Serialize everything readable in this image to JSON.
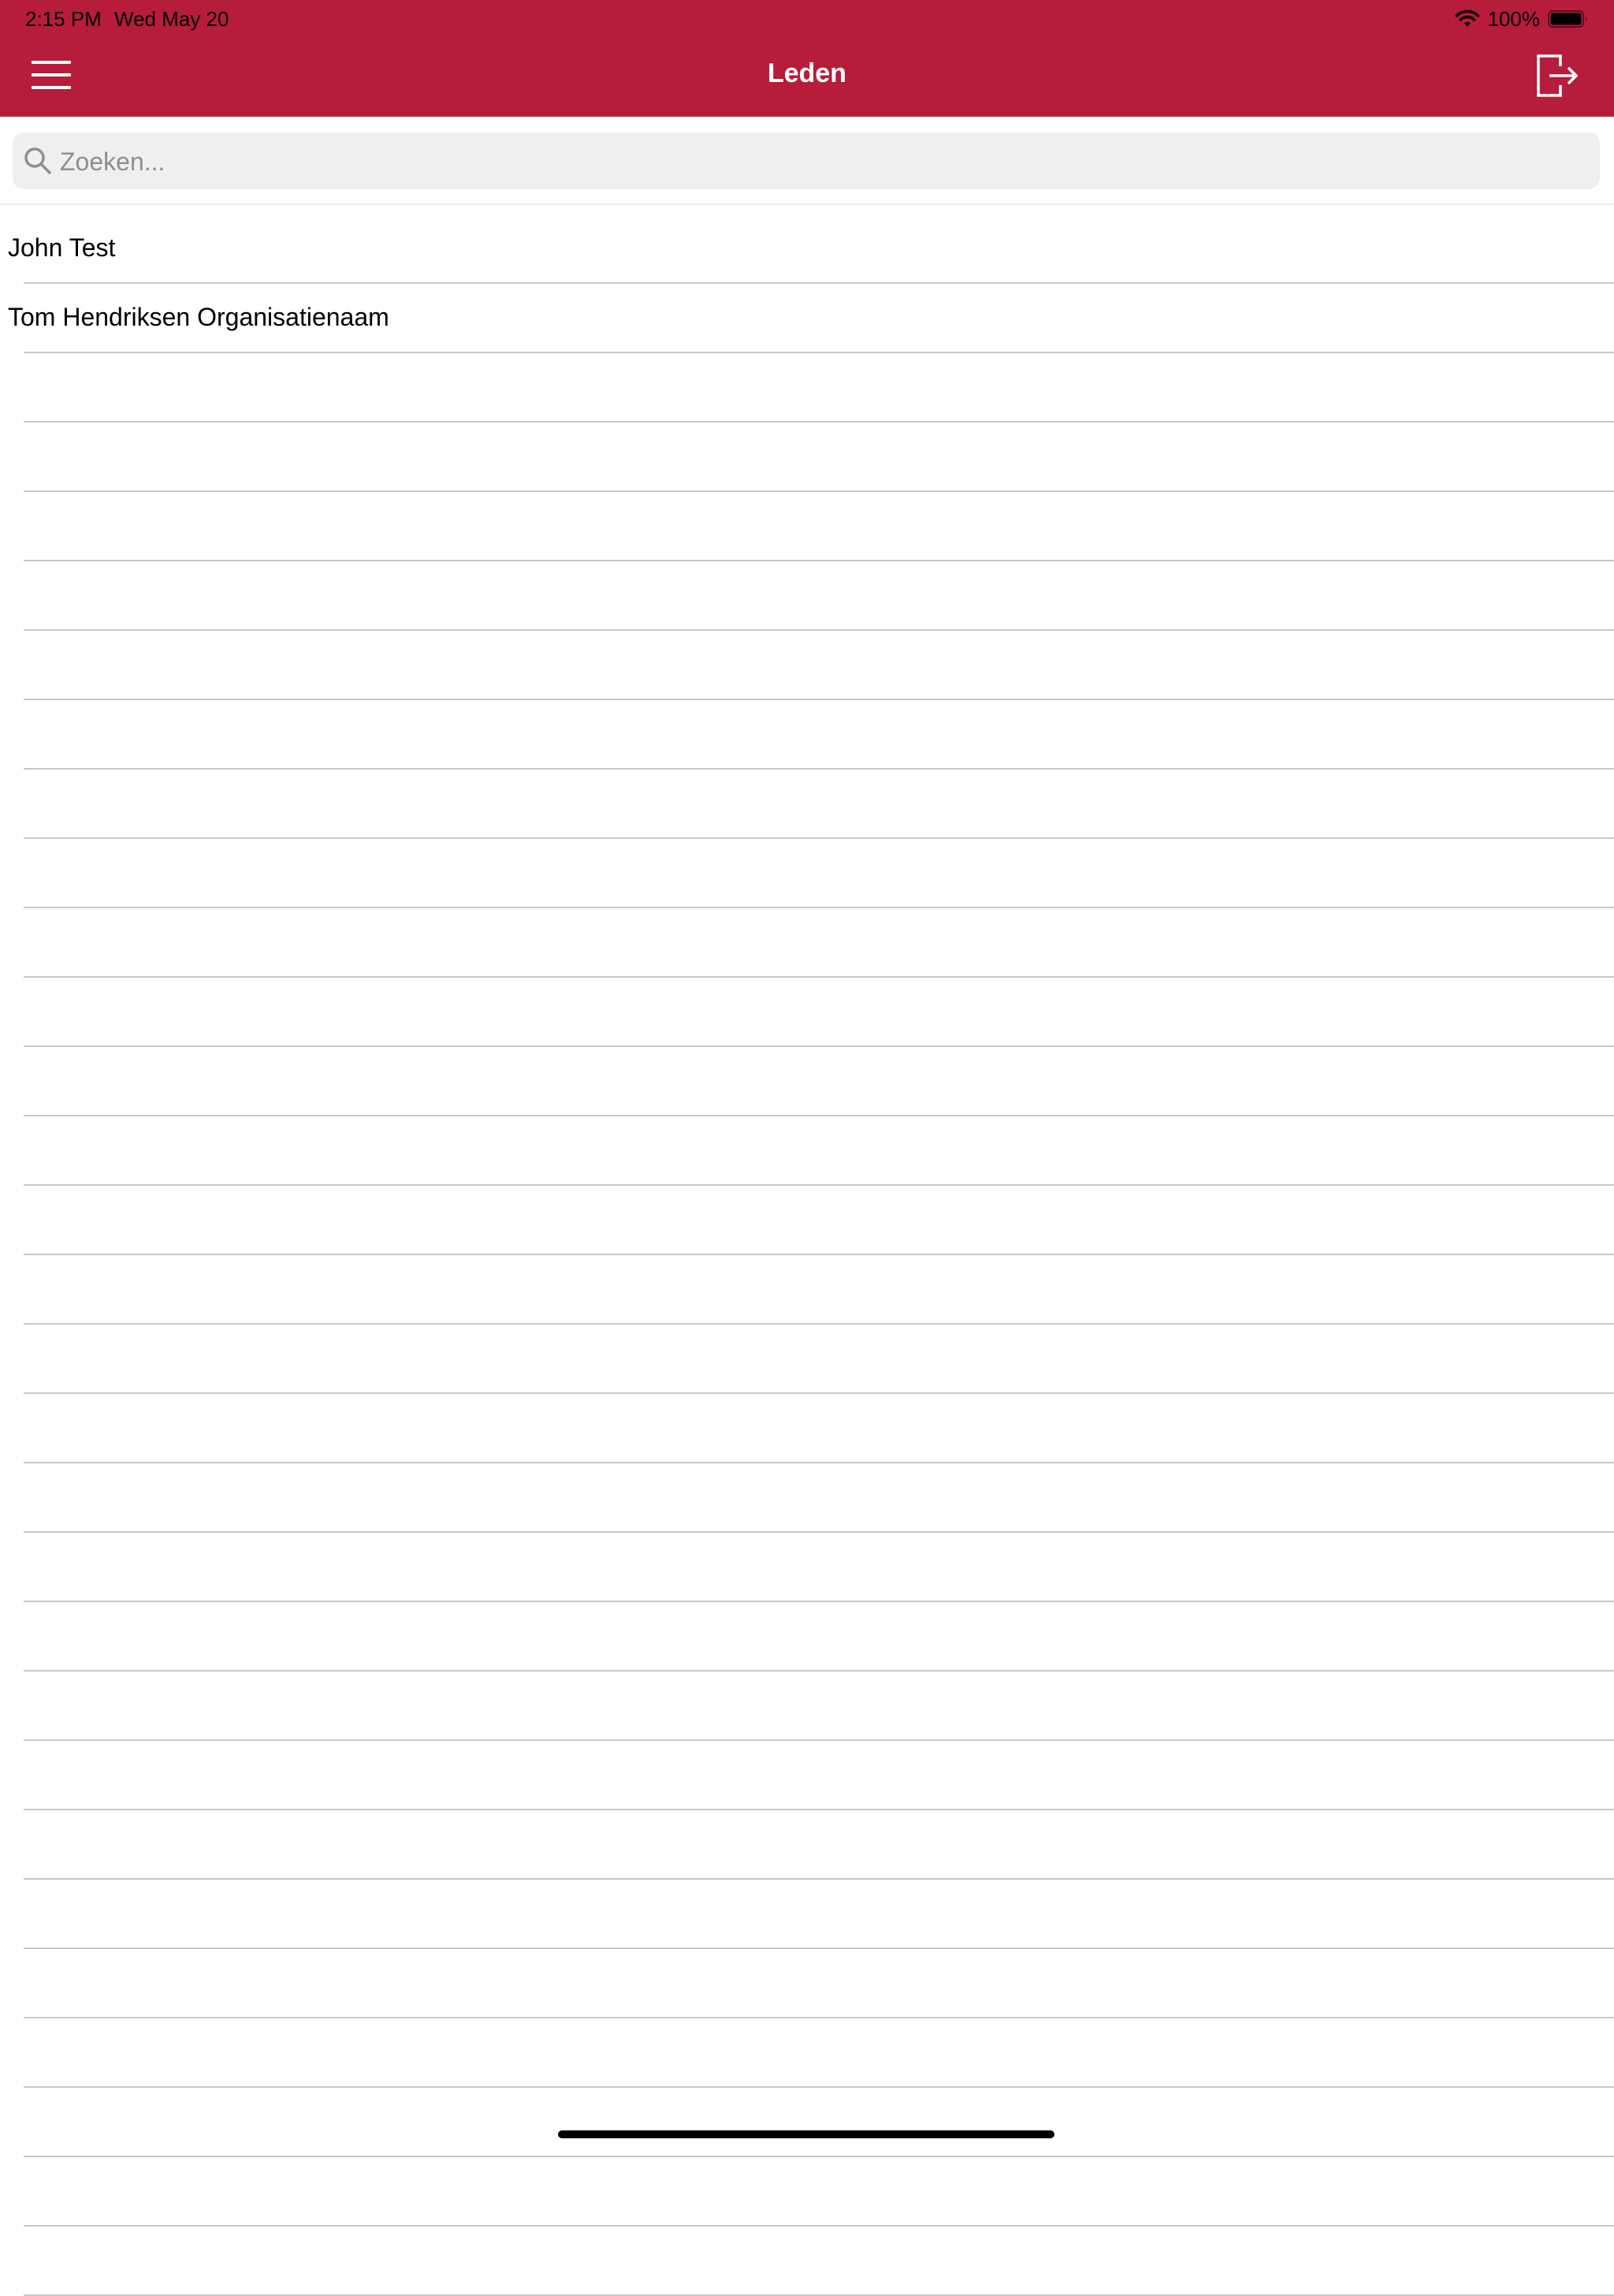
{
  "status_bar": {
    "time": "2:15 PM",
    "date": "Wed May 20",
    "battery": "100%"
  },
  "header": {
    "title": "Leden",
    "background_color": "#b71c3b"
  },
  "icons": {
    "menu": "hamburger-menu-icon",
    "logout": "logout-icon",
    "search": "search-icon",
    "wifi": "wifi-icon",
    "battery": "battery-icon"
  },
  "search": {
    "placeholder": "Zoeken...",
    "value": ""
  },
  "members": [
    {
      "name": "John Test"
    },
    {
      "name": "Tom Hendriksen Organisatienaam"
    },
    {
      "name": ""
    },
    {
      "name": ""
    },
    {
      "name": ""
    },
    {
      "name": ""
    },
    {
      "name": ""
    },
    {
      "name": ""
    },
    {
      "name": ""
    },
    {
      "name": ""
    },
    {
      "name": ""
    },
    {
      "name": ""
    },
    {
      "name": ""
    },
    {
      "name": ""
    },
    {
      "name": ""
    },
    {
      "name": ""
    },
    {
      "name": ""
    },
    {
      "name": ""
    },
    {
      "name": ""
    },
    {
      "name": ""
    },
    {
      "name": ""
    },
    {
      "name": ""
    },
    {
      "name": ""
    },
    {
      "name": ""
    },
    {
      "name": ""
    },
    {
      "name": ""
    },
    {
      "name": ""
    },
    {
      "name": ""
    },
    {
      "name": ""
    },
    {
      "name": ""
    }
  ]
}
